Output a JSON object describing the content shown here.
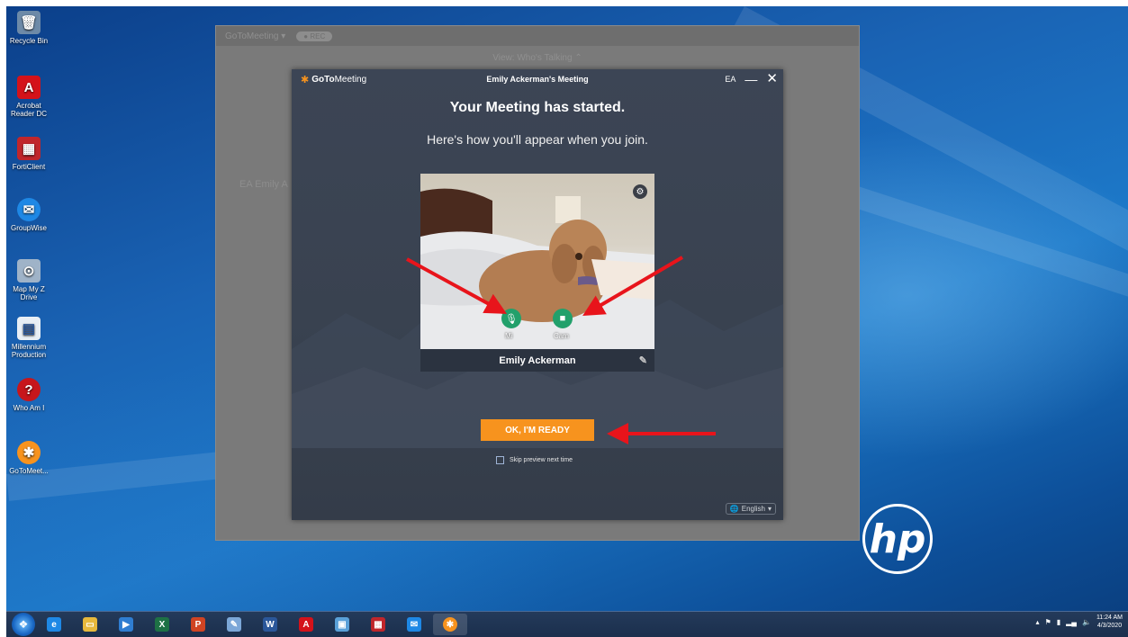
{
  "desktop": {
    "icons": [
      {
        "label": "Recycle Bin",
        "icon": "recycle-bin-icon",
        "color": "#6d8aa8",
        "glyph": "🗑"
      },
      {
        "label": "Acrobat Reader DC",
        "icon": "acrobat-icon",
        "color": "#d4121a",
        "glyph": "A"
      },
      {
        "label": "FortiClient",
        "icon": "forticlient-icon",
        "color": "#c0262b",
        "glyph": "▦"
      },
      {
        "label": "GroupWise",
        "icon": "groupwise-icon",
        "color": "#1e88e5",
        "glyph": "✉"
      },
      {
        "label": "Map My Z Drive",
        "icon": "map-drive-icon",
        "color": "#9fb3c8",
        "glyph": "⊙"
      },
      {
        "label": "Millennium Production",
        "icon": "millennium-icon",
        "color": "#e8eef5",
        "glyph": "▤"
      },
      {
        "label": "Who Am I",
        "icon": "who-am-i-icon",
        "color": "#c7161c",
        "glyph": "?"
      },
      {
        "label": "GoToMeet...",
        "icon": "gotomeeting-icon",
        "color": "#f7931e",
        "glyph": "✱"
      }
    ]
  },
  "gtm_main": {
    "app_label": "GoToMeeting ▾",
    "pill": "● REC",
    "talking": "View: Who's Talking ⌃",
    "ghost_name": "EA  Emily A"
  },
  "modal": {
    "brand_strong": "GoTo",
    "brand_rest": "Meeting",
    "title": "Emily Ackerman's Meeting",
    "initials": "EA",
    "minimize": "—",
    "close": "✕",
    "headline": "Your Meeting has started.",
    "subline": "Here's how you'll appear when you join.",
    "mic_label": "Mi",
    "cam_label": "Cam",
    "participant_name": "Emily Ackerman",
    "ready_button": "OK, I'M READY",
    "skip_label": "Skip preview next time",
    "language": "English"
  },
  "taskbar": {
    "apps": [
      {
        "name": "ie",
        "color": "#1e88e5",
        "glyph": "e"
      },
      {
        "name": "explorer",
        "color": "#e7b83c",
        "glyph": "▭"
      },
      {
        "name": "media",
        "color": "#2f7dd1",
        "glyph": "▶"
      },
      {
        "name": "excel",
        "color": "#1e7145",
        "glyph": "X"
      },
      {
        "name": "powerpoint",
        "color": "#d04423",
        "glyph": "P"
      },
      {
        "name": "paint",
        "color": "#7ca7d8",
        "glyph": "✎"
      },
      {
        "name": "word",
        "color": "#2b579a",
        "glyph": "W"
      },
      {
        "name": "acrobat",
        "color": "#d4121a",
        "glyph": "A"
      },
      {
        "name": "remote",
        "color": "#5aa0d8",
        "glyph": "▣"
      },
      {
        "name": "forti",
        "color": "#c0262b",
        "glyph": "▦"
      },
      {
        "name": "mail",
        "color": "#1e88e5",
        "glyph": "✉"
      },
      {
        "name": "gotomeeting",
        "color": "#f7931e",
        "glyph": "✱"
      }
    ],
    "time": "11:24 AM",
    "date": "4/3/2020"
  },
  "colors": {
    "accent_orange": "#f7931e",
    "button_green": "#22a06b",
    "arrow_red": "#e8141b"
  }
}
